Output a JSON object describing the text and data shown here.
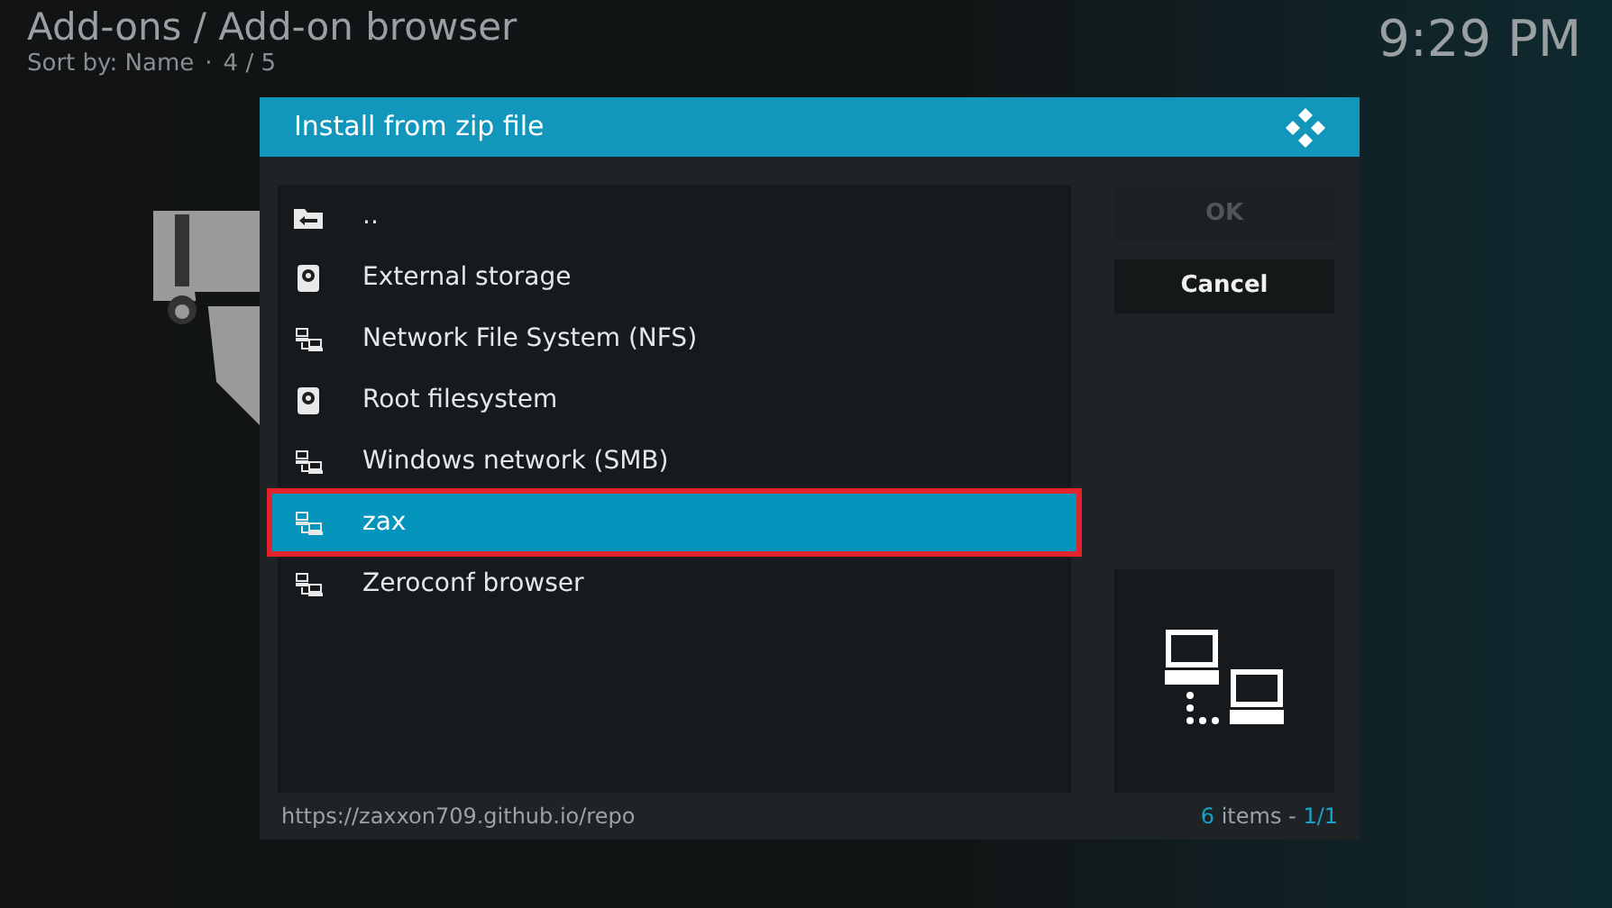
{
  "header": {
    "title": "Add-ons / Add-on browser",
    "sort": "Sort by: Name",
    "separator": "·",
    "position": "4 / 5"
  },
  "clock": "9:29 PM",
  "dialog": {
    "title": "Install from zip file",
    "items": [
      {
        "label": "..",
        "kind": "parent",
        "selected": false
      },
      {
        "label": "External storage",
        "kind": "drive",
        "selected": false
      },
      {
        "label": "Network File System (NFS)",
        "kind": "network",
        "selected": false
      },
      {
        "label": "Root filesystem",
        "kind": "drive",
        "selected": false
      },
      {
        "label": "Windows network (SMB)",
        "kind": "network",
        "selected": false
      },
      {
        "label": "zax",
        "kind": "network",
        "selected": true
      },
      {
        "label": "Zeroconf browser",
        "kind": "network",
        "selected": false
      }
    ],
    "buttons": [
      {
        "label": "OK",
        "disabled": true
      },
      {
        "label": "Cancel",
        "disabled": false
      }
    ],
    "path": "https://zaxxon709.github.io/repo",
    "count": "6",
    "count_label": "items -",
    "page": "1/1"
  }
}
